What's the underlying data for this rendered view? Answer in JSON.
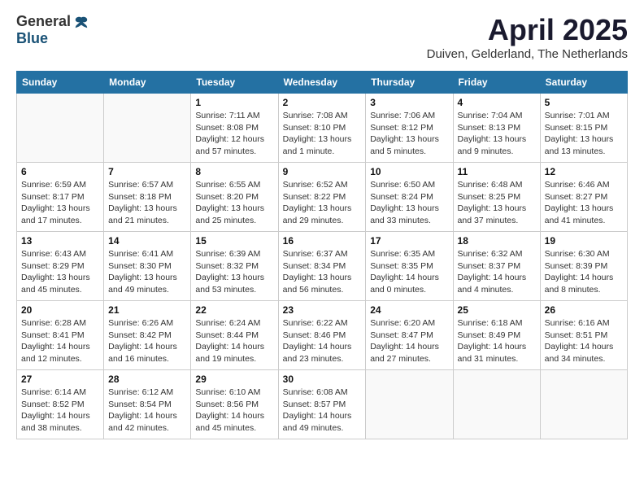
{
  "logo": {
    "general": "General",
    "blue": "Blue"
  },
  "title": "April 2025",
  "location": "Duiven, Gelderland, The Netherlands",
  "headers": [
    "Sunday",
    "Monday",
    "Tuesday",
    "Wednesday",
    "Thursday",
    "Friday",
    "Saturday"
  ],
  "weeks": [
    [
      {
        "day": "",
        "info": ""
      },
      {
        "day": "",
        "info": ""
      },
      {
        "day": "1",
        "info": "Sunrise: 7:11 AM\nSunset: 8:08 PM\nDaylight: 12 hours\nand 57 minutes."
      },
      {
        "day": "2",
        "info": "Sunrise: 7:08 AM\nSunset: 8:10 PM\nDaylight: 13 hours\nand 1 minute."
      },
      {
        "day": "3",
        "info": "Sunrise: 7:06 AM\nSunset: 8:12 PM\nDaylight: 13 hours\nand 5 minutes."
      },
      {
        "day": "4",
        "info": "Sunrise: 7:04 AM\nSunset: 8:13 PM\nDaylight: 13 hours\nand 9 minutes."
      },
      {
        "day": "5",
        "info": "Sunrise: 7:01 AM\nSunset: 8:15 PM\nDaylight: 13 hours\nand 13 minutes."
      }
    ],
    [
      {
        "day": "6",
        "info": "Sunrise: 6:59 AM\nSunset: 8:17 PM\nDaylight: 13 hours\nand 17 minutes."
      },
      {
        "day": "7",
        "info": "Sunrise: 6:57 AM\nSunset: 8:18 PM\nDaylight: 13 hours\nand 21 minutes."
      },
      {
        "day": "8",
        "info": "Sunrise: 6:55 AM\nSunset: 8:20 PM\nDaylight: 13 hours\nand 25 minutes."
      },
      {
        "day": "9",
        "info": "Sunrise: 6:52 AM\nSunset: 8:22 PM\nDaylight: 13 hours\nand 29 minutes."
      },
      {
        "day": "10",
        "info": "Sunrise: 6:50 AM\nSunset: 8:24 PM\nDaylight: 13 hours\nand 33 minutes."
      },
      {
        "day": "11",
        "info": "Sunrise: 6:48 AM\nSunset: 8:25 PM\nDaylight: 13 hours\nand 37 minutes."
      },
      {
        "day": "12",
        "info": "Sunrise: 6:46 AM\nSunset: 8:27 PM\nDaylight: 13 hours\nand 41 minutes."
      }
    ],
    [
      {
        "day": "13",
        "info": "Sunrise: 6:43 AM\nSunset: 8:29 PM\nDaylight: 13 hours\nand 45 minutes."
      },
      {
        "day": "14",
        "info": "Sunrise: 6:41 AM\nSunset: 8:30 PM\nDaylight: 13 hours\nand 49 minutes."
      },
      {
        "day": "15",
        "info": "Sunrise: 6:39 AM\nSunset: 8:32 PM\nDaylight: 13 hours\nand 53 minutes."
      },
      {
        "day": "16",
        "info": "Sunrise: 6:37 AM\nSunset: 8:34 PM\nDaylight: 13 hours\nand 56 minutes."
      },
      {
        "day": "17",
        "info": "Sunrise: 6:35 AM\nSunset: 8:35 PM\nDaylight: 14 hours\nand 0 minutes."
      },
      {
        "day": "18",
        "info": "Sunrise: 6:32 AM\nSunset: 8:37 PM\nDaylight: 14 hours\nand 4 minutes."
      },
      {
        "day": "19",
        "info": "Sunrise: 6:30 AM\nSunset: 8:39 PM\nDaylight: 14 hours\nand 8 minutes."
      }
    ],
    [
      {
        "day": "20",
        "info": "Sunrise: 6:28 AM\nSunset: 8:41 PM\nDaylight: 14 hours\nand 12 minutes."
      },
      {
        "day": "21",
        "info": "Sunrise: 6:26 AM\nSunset: 8:42 PM\nDaylight: 14 hours\nand 16 minutes."
      },
      {
        "day": "22",
        "info": "Sunrise: 6:24 AM\nSunset: 8:44 PM\nDaylight: 14 hours\nand 19 minutes."
      },
      {
        "day": "23",
        "info": "Sunrise: 6:22 AM\nSunset: 8:46 PM\nDaylight: 14 hours\nand 23 minutes."
      },
      {
        "day": "24",
        "info": "Sunrise: 6:20 AM\nSunset: 8:47 PM\nDaylight: 14 hours\nand 27 minutes."
      },
      {
        "day": "25",
        "info": "Sunrise: 6:18 AM\nSunset: 8:49 PM\nDaylight: 14 hours\nand 31 minutes."
      },
      {
        "day": "26",
        "info": "Sunrise: 6:16 AM\nSunset: 8:51 PM\nDaylight: 14 hours\nand 34 minutes."
      }
    ],
    [
      {
        "day": "27",
        "info": "Sunrise: 6:14 AM\nSunset: 8:52 PM\nDaylight: 14 hours\nand 38 minutes."
      },
      {
        "day": "28",
        "info": "Sunrise: 6:12 AM\nSunset: 8:54 PM\nDaylight: 14 hours\nand 42 minutes."
      },
      {
        "day": "29",
        "info": "Sunrise: 6:10 AM\nSunset: 8:56 PM\nDaylight: 14 hours\nand 45 minutes."
      },
      {
        "day": "30",
        "info": "Sunrise: 6:08 AM\nSunset: 8:57 PM\nDaylight: 14 hours\nand 49 minutes."
      },
      {
        "day": "",
        "info": ""
      },
      {
        "day": "",
        "info": ""
      },
      {
        "day": "",
        "info": ""
      }
    ]
  ]
}
